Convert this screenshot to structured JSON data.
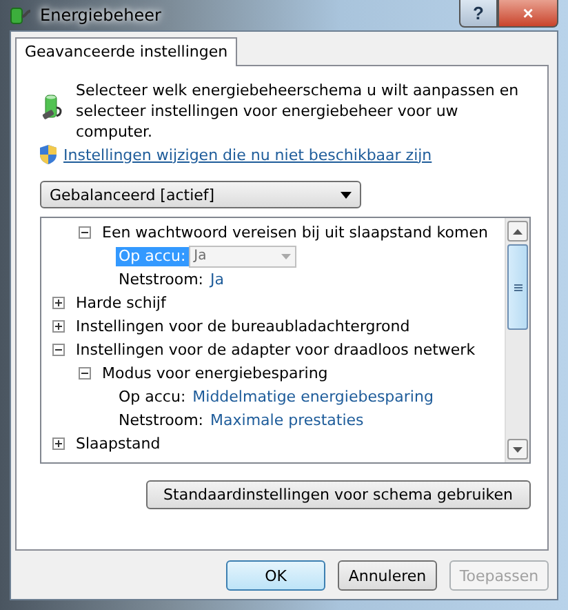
{
  "window": {
    "title": "Energiebeheer",
    "help_button": "?",
    "close_button": "×"
  },
  "tabs": [
    {
      "label": "Geavanceerde instellingen",
      "selected": true
    }
  ],
  "intro": "Selecteer welk energiebeheerschema u wilt aanpassen en selecteer instellingen voor energiebeheer voor uw computer.",
  "link": "Instellingen wijzigen die nu niet beschikbaar zijn",
  "scheme_select": {
    "value": "Gebalanceerd [actief]"
  },
  "tree": {
    "continued": [
      {
        "kind": "node",
        "label": "Een wachtwoord vereisen bij uit slaapstand komen",
        "expanded": true,
        "children": [
          {
            "kind": "setting",
            "label": "Op accu:",
            "value": "Ja",
            "selected": true
          },
          {
            "kind": "setting",
            "label": "Netstroom:",
            "value": "Ja",
            "selected": false
          }
        ]
      }
    ],
    "items": [
      {
        "kind": "node",
        "label": "Harde schijf",
        "expanded": false
      },
      {
        "kind": "node",
        "label": "Instellingen voor de bureaubladachtergrond",
        "expanded": false
      },
      {
        "kind": "node",
        "label": "Instellingen voor de adapter voor draadloos netwerk",
        "expanded": true,
        "children": [
          {
            "kind": "node",
            "label": "Modus voor energiebesparing",
            "expanded": true,
            "children": [
              {
                "kind": "setting",
                "label": "Op accu:",
                "value": "Middelmatige energiebesparing",
                "selected": false
              },
              {
                "kind": "setting",
                "label": "Netstroom:",
                "value": "Maximale prestaties",
                "selected": false
              }
            ]
          }
        ]
      },
      {
        "kind": "node",
        "label": "Slaapstand",
        "expanded": false
      }
    ]
  },
  "restore_button": "Standaardinstellingen voor schema gebruiken",
  "buttons": [
    {
      "label": "OK",
      "disabled": false,
      "default": true
    },
    {
      "label": "Annuleren",
      "disabled": false,
      "default": false
    },
    {
      "label": "Toepassen",
      "disabled": true,
      "default": false
    }
  ]
}
